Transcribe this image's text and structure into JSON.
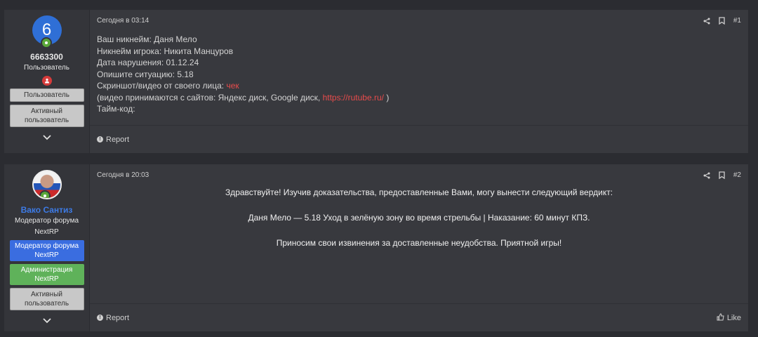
{
  "posts": [
    {
      "number": "#1",
      "date": "Сегодня в 03:14",
      "user": {
        "avatar_text": "6",
        "name": "6663300",
        "title": "Пользователь",
        "badges": [
          "Пользователь",
          "Активный пользователь"
        ]
      },
      "lines": {
        "nick": "Ваш никнейм: Даня Мело",
        "player": "Никнейм игрока: Никита Манцуров",
        "date": "Дата нарушения: 01.12.24",
        "situation": "Опишите ситуацию: 5.18",
        "proof_label": "Скриншот/видео от своего лица:",
        "proof_link": "чек",
        "video_prefix": "(видео принимаются с сайтов: Яндекс диск, Google диск,",
        "video_link": "https://rutube.ru/",
        "video_suffix": ")",
        "timecode": "Тайм-код:"
      },
      "report_label": "Report"
    },
    {
      "number": "#2",
      "date": "Сегодня в 20:03",
      "user": {
        "name": "Вако Сантиз",
        "title_line1": "Модератор форума",
        "title_line2": "NextRP",
        "badges": [
          "Модератор форума NextRP",
          "Администрация NextRP",
          "Активный пользователь"
        ]
      },
      "paragraphs": [
        "Здравствуйте! Изучив доказательства, предоставленные Вами, могу вынести следующий вердикт:",
        "Даня Мело — 5.18 Уход в зелёную зону во время стрельбы | Наказание: 60 минут КПЗ.",
        "Приносим свои извинения за доставленные неудобства. Приятной игры!"
      ],
      "report_label": "Report",
      "like_label": "Like"
    }
  ],
  "colors": {
    "background": "#2b2c31",
    "post": "#38393e",
    "link_red": "#e84c4c",
    "moderator_blue": "#3a6de0",
    "admin_green": "#5fb25a"
  },
  "icons": [
    "share-icon",
    "bookmark-icon",
    "online-icon",
    "role-icon",
    "chevron-down-icon",
    "report-icon",
    "like-icon"
  ]
}
